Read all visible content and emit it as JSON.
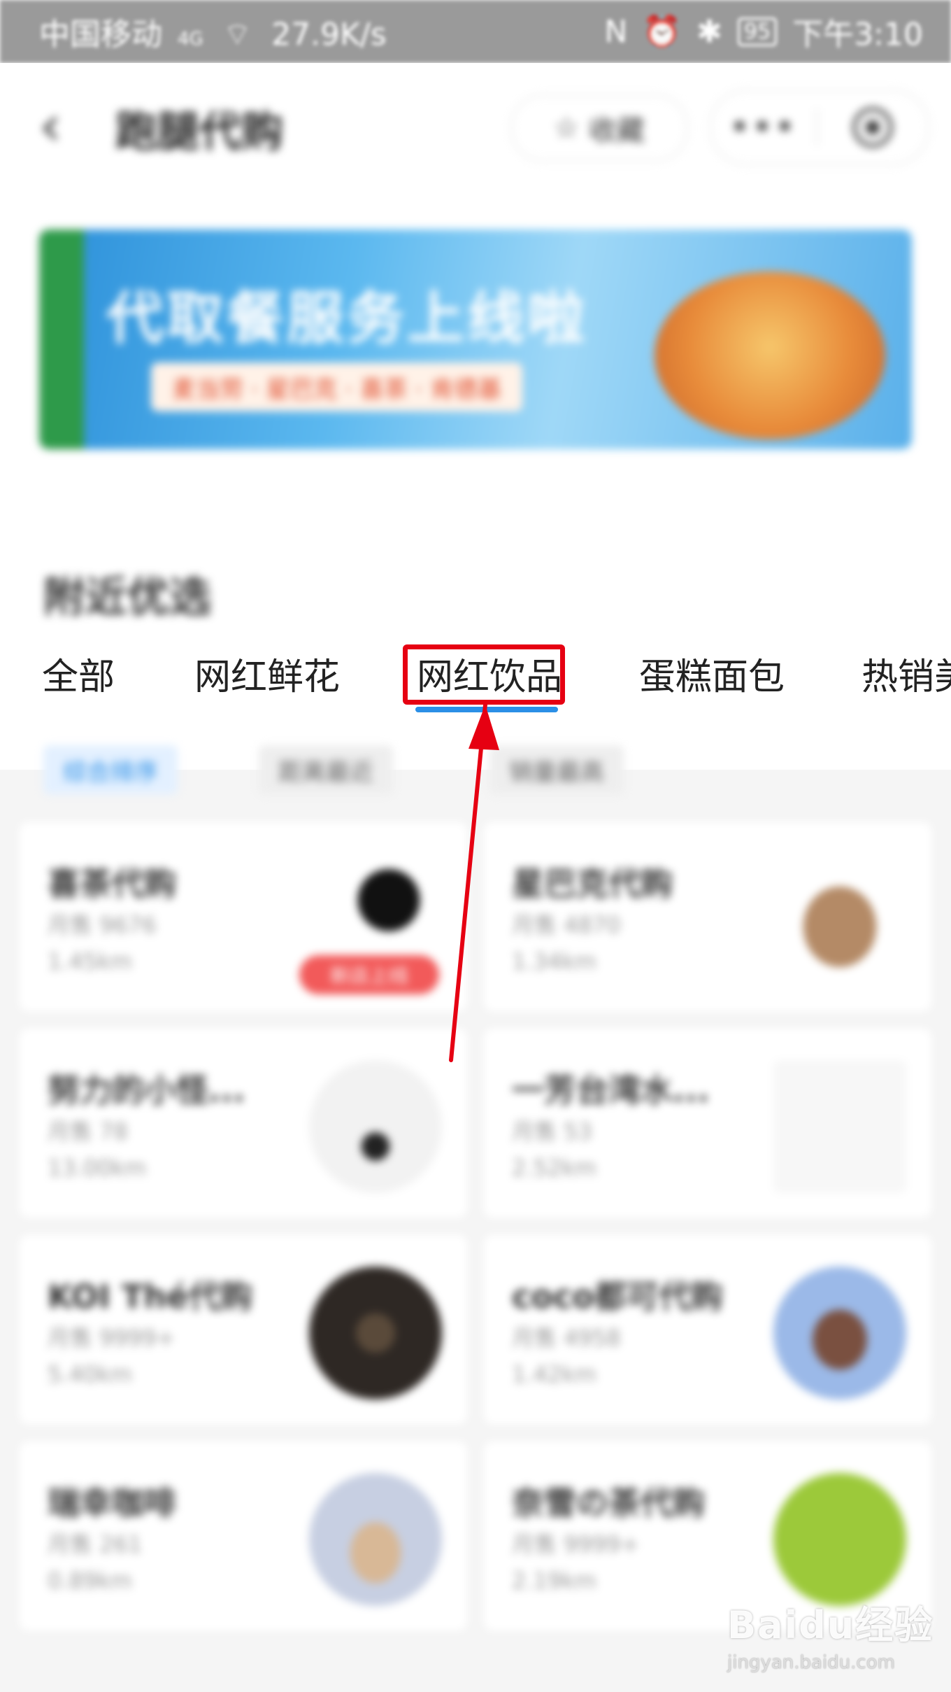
{
  "status_bar": {
    "carrier": "中国移动",
    "network": "4G",
    "speed": "27.9K/s",
    "battery": "95",
    "time": "下午3:10"
  },
  "nav": {
    "title": "跑腿代购",
    "favorite_label": "收藏",
    "more_label": "•••"
  },
  "banner": {
    "headline": "代取餐服务上线啦",
    "subline": "麦当劳 · 星巴克 · 喜茶 · 肯德基"
  },
  "section_title": "附近优选",
  "tabs": [
    {
      "label": "全部"
    },
    {
      "label": "网红鲜花"
    },
    {
      "label": "网红饮品"
    },
    {
      "label": "蛋糕面包"
    },
    {
      "label": "热销美"
    }
  ],
  "selected_tab": "网红饮品",
  "sort_options": [
    {
      "label": "综合排序"
    },
    {
      "label": "距离最近"
    },
    {
      "label": "销量最高"
    }
  ],
  "shops": [
    {
      "name": "喜茶代购",
      "sales": "月售 9676",
      "distance": "1.45km",
      "tag": "新店上线"
    },
    {
      "name": "星巴克代购",
      "sales": "月售 4870",
      "distance": "1.34km",
      "tag": ""
    },
    {
      "name": "努力的小怪...",
      "sales": "月售 78",
      "distance": "13.00km",
      "tag": ""
    },
    {
      "name": "一芳台湾水...",
      "sales": "月售 53",
      "distance": "2.52km",
      "tag": ""
    },
    {
      "name": "KOI Thé代购",
      "sales": "月售 9999+",
      "distance": "5.40km",
      "tag": ""
    },
    {
      "name": "coco都可代购",
      "sales": "月售 4958",
      "distance": "1.42km",
      "tag": ""
    },
    {
      "name": "瑞幸咖啡",
      "sales": "月售 261",
      "distance": "0.89km",
      "tag": ""
    },
    {
      "name": "奈雪の茶代购",
      "sales": "月售 9999+",
      "distance": "2.19km",
      "tag": ""
    }
  ],
  "watermark": {
    "main": "Baidu经验",
    "sub": "jingyan.baidu.com"
  },
  "colors": {
    "accent": "#2b8fe6",
    "highlight": "#e60012",
    "tag": "#f25a5a"
  }
}
